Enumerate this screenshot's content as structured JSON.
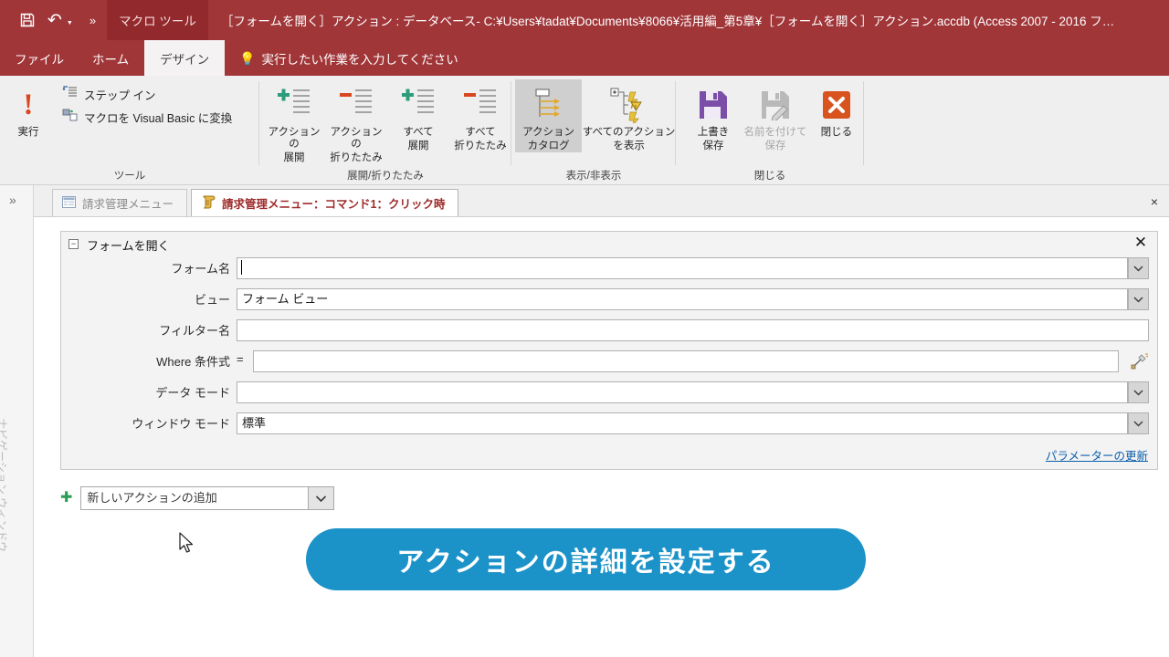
{
  "titlebar": {
    "quick_access": [
      {
        "name": "save-icon",
        "label": "上書き保存"
      },
      {
        "name": "undo-icon",
        "label": "元に戻す"
      },
      {
        "name": "customize-qat-icon",
        "label": "クイック アクセス ツール バーのユーザー設定"
      }
    ],
    "context_tab": "マクロ ツール",
    "window_title": "［フォームを開く］アクション : データベース- C:¥Users¥tadat¥Documents¥8066¥活用編_第5章¥［フォームを開く］アクション.accdb (Access 2007 - 2016 フ…",
    "bg_color": "#a13639"
  },
  "ribbon": {
    "tabs": [
      {
        "label": "ファイル",
        "active": false
      },
      {
        "label": "ホーム",
        "active": false
      },
      {
        "label": "デザイン",
        "active": true
      }
    ],
    "tell_me": "実行したい作業を入力してください",
    "groups": [
      {
        "label": "ツール",
        "big_buttons": [
          {
            "label_line1": "実行",
            "label_line2": "",
            "icon": "exclamation-run-icon",
            "state": "normal"
          }
        ],
        "small_buttons": [
          {
            "label": "ステップ イン",
            "icon": "step-into-icon"
          },
          {
            "label": "マクロを Visual Basic に変換",
            "icon": "convert-macro-icon"
          }
        ]
      },
      {
        "label": "展開/折りたたみ",
        "big_buttons": [
          {
            "label_line1": "アクションの",
            "label_line2": "展開",
            "icon": "expand-action-icon",
            "state": "normal"
          },
          {
            "label_line1": "アクションの",
            "label_line2": "折りたたみ",
            "icon": "collapse-action-icon",
            "state": "normal"
          },
          {
            "label_line1": "すべて",
            "label_line2": "展開",
            "icon": "expand-all-icon",
            "state": "normal"
          },
          {
            "label_line1": "すべて",
            "label_line2": "折りたたみ",
            "icon": "collapse-all-icon",
            "state": "normal"
          }
        ],
        "small_buttons": []
      },
      {
        "label": "表示/非表示",
        "big_buttons": [
          {
            "label_line1": "アクション",
            "label_line2": "カタログ",
            "icon": "action-catalog-icon",
            "state": "selected"
          },
          {
            "label_line1": "すべてのアクション",
            "label_line2": "を表示",
            "icon": "show-all-actions-icon",
            "state": "normal"
          }
        ],
        "small_buttons": []
      },
      {
        "label": "閉じる",
        "big_buttons": [
          {
            "label_line1": "上書き",
            "label_line2": "保存",
            "icon": "save-disk-icon",
            "state": "normal"
          },
          {
            "label_line1": "名前を付けて",
            "label_line2": "保存",
            "icon": "save-as-icon",
            "state": "disabled"
          },
          {
            "label_line1": "閉じる",
            "label_line2": "",
            "icon": "close-x-icon",
            "state": "normal"
          }
        ],
        "small_buttons": []
      }
    ]
  },
  "navpane": {
    "expand_icon": "chevron-double-right-icon",
    "label": "ナビゲーション ウィンドウ"
  },
  "doctabs": {
    "tabs": [
      {
        "label": "請求管理メニュー",
        "icon": "form-icon",
        "active": false
      },
      {
        "label": "請求管理メニュー：コマンド1：クリック時",
        "icon": "macro-scroll-icon",
        "active": true
      }
    ],
    "close_label": "×"
  },
  "action_block": {
    "collapse_glyph": "−",
    "title": "フォームを開く",
    "close_glyph": "✕",
    "fields": [
      {
        "label": "フォーム名",
        "value": "",
        "control": "combo",
        "focused": true
      },
      {
        "label": "ビュー",
        "value": "フォーム ビュー",
        "control": "combo",
        "focused": false
      },
      {
        "label": "フィルター名",
        "value": "",
        "control": "text",
        "focused": false
      },
      {
        "label": "Where 条件式",
        "value": "",
        "control": "where",
        "focused": false,
        "prefix": "="
      },
      {
        "label": "データ モード",
        "value": "",
        "control": "combo",
        "focused": false
      },
      {
        "label": "ウィンドウ モード",
        "value": "標準",
        "control": "combo",
        "focused": false
      }
    ],
    "param_link": "パラメーターの更新",
    "builder_icon": "expression-builder-icon"
  },
  "add_action": {
    "plus_icon": "plus-icon",
    "placeholder": "新しいアクションの追加",
    "arrow_icon": "chevron-down-icon"
  },
  "cta": {
    "label": "アクションの詳細を設定する",
    "color": "#1b92c8"
  },
  "cursor": {
    "icon": "mouse-pointer-icon"
  }
}
